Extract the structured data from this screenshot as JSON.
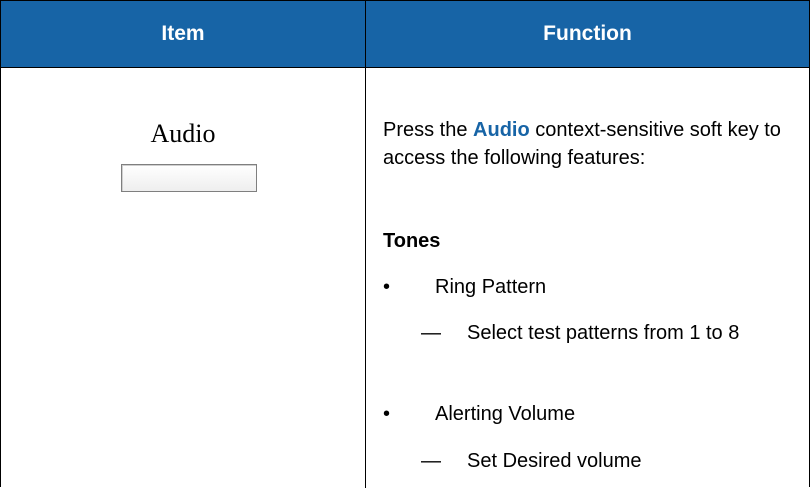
{
  "header": {
    "item_label": "Item",
    "function_label": "Function",
    "bg_color": "#1764a6"
  },
  "item": {
    "label": "Audio"
  },
  "function": {
    "intro_prefix": "Press the",
    "intro_keyword": "Audio",
    "intro_suffix": "context-sensitive soft key to access the following features:",
    "section_title": "Tones",
    "bullets": [
      {
        "symbol": "•",
        "text": "Ring Pattern",
        "sub": {
          "symbol": "—",
          "text": "Select test patterns from 1 to 8"
        }
      },
      {
        "symbol": "•",
        "text": "Alerting Volume",
        "sub": {
          "symbol": "—",
          "text": "Set Desired volume"
        }
      }
    ]
  }
}
